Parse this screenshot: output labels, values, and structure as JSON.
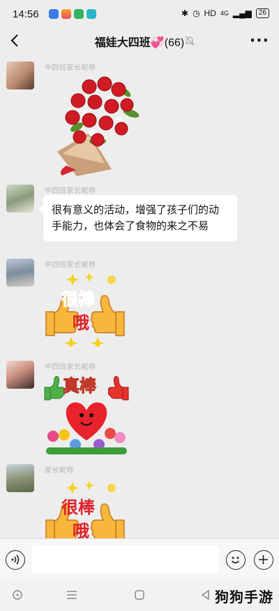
{
  "status_bar": {
    "time": "14:56",
    "network": "HD",
    "signal": "4G",
    "battery": "26"
  },
  "header": {
    "title": "福娃大四班",
    "member_count": "(66)"
  },
  "messages": [
    {
      "sender": "中四班家长昵称",
      "type": "sticker",
      "sticker": "rose-bouquet"
    },
    {
      "sender": "中四班家长昵称",
      "type": "text",
      "text": "很有意义的活动，增强了孩子们的动手能力，也体会了食物的来之不易"
    },
    {
      "sender": "中四班家长昵称",
      "type": "sticker",
      "sticker": "thumbs-up",
      "sticker_text": [
        "很棒",
        "哦"
      ]
    },
    {
      "sender": "中四班家长昵称",
      "type": "sticker",
      "sticker": "heart-thumbs",
      "sticker_text": [
        "真棒"
      ]
    },
    {
      "sender": "家长昵称",
      "type": "sticker",
      "sticker": "thumbs-up",
      "sticker_text": [
        "很棒",
        "哦"
      ]
    }
  ],
  "watermark": "狗狗手游",
  "colors": {
    "background": "#ededed",
    "bubble": "#ffffff",
    "sticker_red": "#e8232b",
    "sticker_gold": "#f5c518"
  }
}
